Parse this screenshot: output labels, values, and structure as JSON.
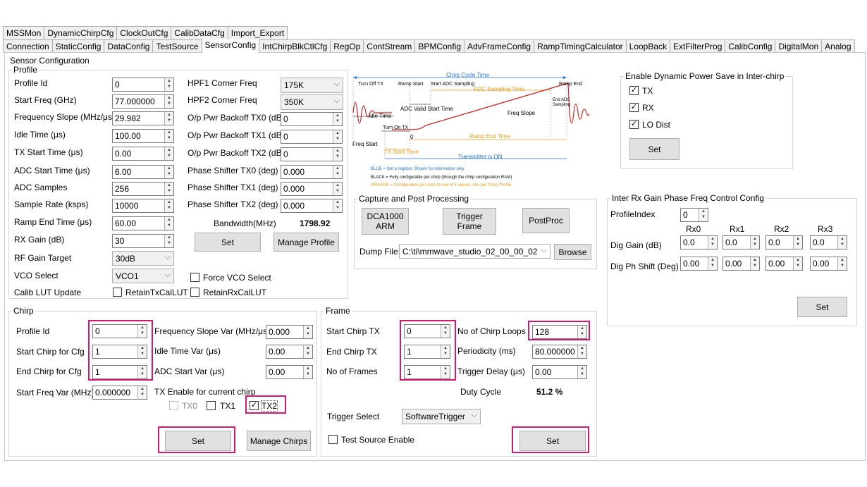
{
  "tabs_row1": [
    "MSSMon",
    "DynamicChirpCfg",
    "ClockOutCfg",
    "CalibDataCfg",
    "Import_Export"
  ],
  "tabs_row2": [
    "Connection",
    "StaticConfig",
    "DataConfig",
    "TestSource",
    "SensorConfig",
    "IntChirpBlkCtlCfg",
    "RegOp",
    "ContStream",
    "BPMConfig",
    "AdvFrameConfig",
    "RampTimingCalculator",
    "LoopBack",
    "ExtFilterProg",
    "CalibConfig",
    "DigitalMon",
    "Analog"
  ],
  "sensor_title": "Sensor Configuration",
  "profile": {
    "legend": "Profile",
    "fields": [
      {
        "label": "Profile Id",
        "value": "0"
      },
      {
        "label": "Start Freq (GHz)",
        "value": "77.000000"
      },
      {
        "label": "Frequency Slope (MHz/μs)",
        "value": "29.982"
      },
      {
        "label": "Idle Time (μs)",
        "value": "100.00"
      },
      {
        "label": "TX Start Time (μs)",
        "value": "0.00"
      },
      {
        "label": "ADC Start Time (μs)",
        "value": "6.00"
      },
      {
        "label": "ADC Samples",
        "value": "256"
      },
      {
        "label": "Sample Rate (ksps)",
        "value": "10000"
      },
      {
        "label": "Ramp End Time (μs)",
        "value": "60.00"
      },
      {
        "label": "RX Gain (dB)",
        "value": "30"
      }
    ],
    "rf_gain_label": "RF Gain Target",
    "rf_gain_value": "30dB",
    "vco_label": "VCO Select",
    "vco_value": "VCO1",
    "calib_label": "Calib LUT Update",
    "retain_tx": "RetainTxCalLUT",
    "retain_rx": "RetainRxCalLUT",
    "force_vco": "Force VCO Select",
    "hpf1_label": "HPF1 Corner Freq",
    "hpf1_value": "175K",
    "hpf2_label": "HPF2 Corner Freq",
    "hpf2_value": "350K",
    "right_fields": [
      {
        "label": "O/p Pwr Backoff TX0 (dB)",
        "value": "0"
      },
      {
        "label": "O/p Pwr Backoff TX1 (dB)",
        "value": "0"
      },
      {
        "label": "O/p Pwr Backoff TX2 (dB)",
        "value": "0"
      },
      {
        "label": "Phase Shifter TX0 (deg)",
        "value": "0.000"
      },
      {
        "label": "Phase Shifter TX1 (deg)",
        "value": "0.000"
      },
      {
        "label": "Phase Shifter TX2 (deg)",
        "value": "0.000"
      }
    ],
    "bandwidth_label": "Bandwidth(MHz)",
    "bandwidth_value": "1798.92",
    "set": "Set",
    "manage": "Manage Profile"
  },
  "diagram": {
    "chirp_cycle": "Chirp Cycle Time",
    "turn_off_tx": "Turn Off TX",
    "ramp_start": "Ramp Start",
    "start_adc": "Start ADC Sampling",
    "adc_sampling": "ADC Sampling Time",
    "ramp_end": "Ramp End",
    "end_adc": "End ADC Sampling",
    "adc_valid": "ADC Valid Start Time",
    "freq_slope": "Freq Slope",
    "idle_time": "Idle Time",
    "turn_on_tx": "Turn On TX",
    "freq_start": "Freq Start",
    "zero": "0",
    "ramp_end_time": "Ramp End Time",
    "tx_start": "TX Start Time",
    "tx_on": "Transmitter is ON",
    "legend_blue": "BLUE = Not a register. Shown for information only",
    "legend_black": "BLACK = Fully configurable per chirp (through the chirp configuration RAM)",
    "legend_orange": "ORANGE = Configurable per chirp to one of 4 values, one per Chirp Profile"
  },
  "capture": {
    "legend": "Capture and Post Processing",
    "dca": "DCA1000 ARM",
    "trigger": "Trigger Frame",
    "postproc": "PostProc",
    "dump_label": "Dump File:",
    "dump_value": "C:\\ti\\mmwave_studio_02_00_00_02",
    "browse": "Browse"
  },
  "dps": {
    "legend": "Enable Dynamic Power Save in Inter-chirp",
    "tx": "TX",
    "rx": "RX",
    "lo": "LO Dist",
    "set": "Set"
  },
  "interrx": {
    "legend": "Inter Rx Gain Phase Freq Control Config",
    "profile_label": "ProfileIndex",
    "profile_value": "0",
    "cols": [
      "Rx0",
      "Rx1",
      "Rx2",
      "Rx3"
    ],
    "dig_gain_label": "Dig Gain (dB)",
    "dig_gain": [
      "0.0",
      "0.0",
      "0.0",
      "0.0"
    ],
    "dig_ph_label": "Dig Ph Shift (Deg)",
    "dig_ph": [
      "0.00",
      "0.00",
      "0.00",
      "0.00"
    ],
    "set": "Set"
  },
  "chirp": {
    "legend": "Chirp",
    "profile_label": "Profile Id",
    "profile_value": "0",
    "start_label": "Start Chirp for Cfg",
    "start_value": "1",
    "end_label": "End Chirp for Cfg",
    "end_value": "1",
    "slope_var_label": "Frequency Slope Var (MHz/μs)",
    "slope_var": "0.000",
    "idle_var_label": "Idle Time Var (μs)",
    "idle_var": "0.00",
    "adc_var_label": "ADC Start Var (μs)",
    "adc_var": "0.00",
    "freq_var_label": "Start Freq Var (MHz)",
    "freq_var": "0.000000",
    "tx_enable_label": "TX Enable for current chirp",
    "tx0": "TX0",
    "tx1": "TX1",
    "tx2": "TX2",
    "set": "Set",
    "manage": "Manage Chirps"
  },
  "frame": {
    "legend": "Frame",
    "start_label": "Start Chirp TX",
    "start_value": "0",
    "end_label": "End Chirp TX",
    "end_value": "1",
    "frames_label": "No of Frames",
    "frames_value": "1",
    "loops_label": "No of Chirp Loops",
    "loops_value": "128",
    "period_label": "Periodicity (ms)",
    "period_value": "80.000000",
    "delay_label": "Trigger Delay (μs)",
    "delay_value": "0.00",
    "duty_label": "Duty Cycle",
    "duty_value": "51.2 %",
    "trigger_label": "Trigger Select",
    "trigger_value": "SoftwareTrigger",
    "test_source": "Test Source Enable",
    "set": "Set"
  },
  "colors": {
    "highlight": "#d6166f",
    "diagram_red": "#d4231e",
    "diagram_blue": "#1f6fd6",
    "diagram_orange": "#f39a16"
  }
}
